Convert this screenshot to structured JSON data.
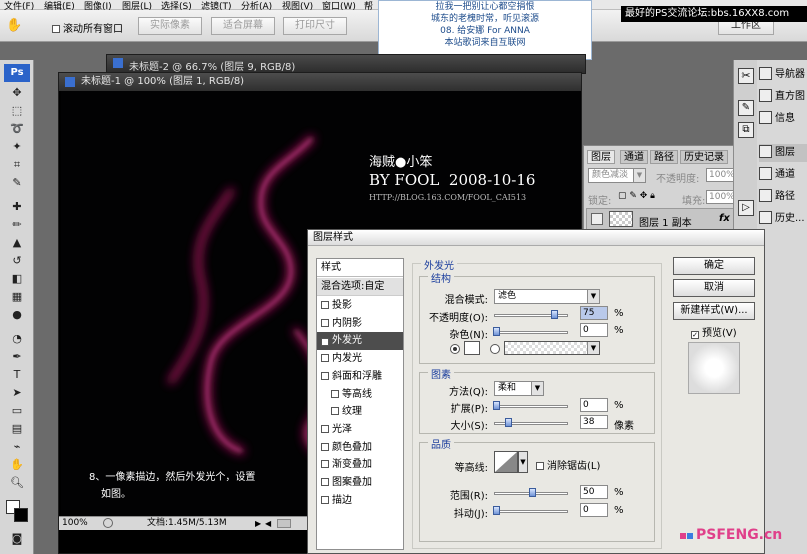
{
  "menu": [
    "文件(F)",
    "编辑(E)",
    "图像(I)",
    "图层(L)",
    "选择(S)",
    "滤镜(T)",
    "分析(A)",
    "视图(V)",
    "窗口(W)",
    "帮"
  ],
  "options_bar": {
    "scroll_all": "滚动所有窗口",
    "actual_pixels": "实际像素",
    "fit_screen": "适合屏幕",
    "print_size": "打印尺寸",
    "workspace": "工作区"
  },
  "popup": {
    "lines": [
      "拉我一把别让心都空捐恨",
      "城东的老槐时常，听见滚源",
      "08. 给安娜 For ANNA",
      "本站歌词来自互联网"
    ]
  },
  "watermark_top": "最好的PS交流论坛:bbs.16XX8.com",
  "doc2_title": "未标题-2 @ 66.7% (图层 9, RGB/8)",
  "doc1_title": "未标题-1 @ 100% (图层 1, RGB/8)",
  "canvas": {
    "line1": "海贼●小笨",
    "line2": "BY FOOL  2008-10-16",
    "line3": "HTTP://BLOG.163.COM/FOOL_CAI513",
    "instruction_1": "8、一像素描边，然后外发光个，设置",
    "instruction_2": "如图。"
  },
  "status": {
    "zoom": "100%",
    "doc": "文档:1.45M/5.13M"
  },
  "dialog": {
    "title": "图层样式",
    "styles_header": "样式",
    "blend_options": "混合选项:自定",
    "styles": [
      {
        "label": "投影",
        "checked": false,
        "indent": false
      },
      {
        "label": "内阴影",
        "checked": false,
        "indent": false
      },
      {
        "label": "外发光",
        "checked": true,
        "indent": false,
        "selected": true
      },
      {
        "label": "内发光",
        "checked": false,
        "indent": false
      },
      {
        "label": "斜面和浮雕",
        "checked": false,
        "indent": false
      },
      {
        "label": "等高线",
        "checked": false,
        "indent": true
      },
      {
        "label": "纹理",
        "checked": false,
        "indent": true
      },
      {
        "label": "光泽",
        "checked": false,
        "indent": false
      },
      {
        "label": "颜色叠加",
        "checked": false,
        "indent": false
      },
      {
        "label": "渐变叠加",
        "checked": false,
        "indent": false
      },
      {
        "label": "图案叠加",
        "checked": false,
        "indent": false
      },
      {
        "label": "描边",
        "checked": false,
        "indent": false
      }
    ],
    "section_title": "外发光",
    "structure": {
      "title": "结构",
      "blend_mode_label": "混合模式:",
      "blend_mode_value": "滤色",
      "opacity_label": "不透明度(O):",
      "opacity_value": "75",
      "noise_label": "杂色(N):",
      "noise_value": "0",
      "percent": "%"
    },
    "elements": {
      "title": "图素",
      "method_label": "方法(Q):",
      "method_value": "柔和",
      "spread_label": "扩展(P):",
      "spread_value": "0",
      "size_label": "大小(S):",
      "size_value": "38",
      "size_unit": "像素",
      "percent": "%"
    },
    "quality": {
      "title": "品质",
      "contour_label": "等高线:",
      "antialias_label": "消除锯齿(L)",
      "range_label": "范围(R):",
      "range_value": "50",
      "jitter_label": "抖动(J):",
      "jitter_value": "0",
      "percent": "%"
    },
    "buttons": {
      "ok": "确定",
      "cancel": "取消",
      "new_style": "新建样式(W)...",
      "preview": "预览(V)"
    }
  },
  "layers_panel": {
    "tabs": [
      "图层",
      "通道",
      "路径",
      "历史记录"
    ],
    "blend_mode": "颜色减淡",
    "opacity_label": "不透明度:",
    "opacity_value": "100%",
    "lock_label": "锁定:",
    "fill_label": "填充:",
    "fill_value": "100%",
    "layer_name": "图层 1 副本",
    "fx": "fx"
  },
  "right_panel": [
    "导航器",
    "直方图",
    "信息",
    "图层",
    "通道",
    "路径",
    "历史..."
  ],
  "brand": "PSFENG.cn",
  "colors": {
    "glow": "#c2186a",
    "accent": "#1a3d9d",
    "brand_pink": "#e0408a"
  }
}
